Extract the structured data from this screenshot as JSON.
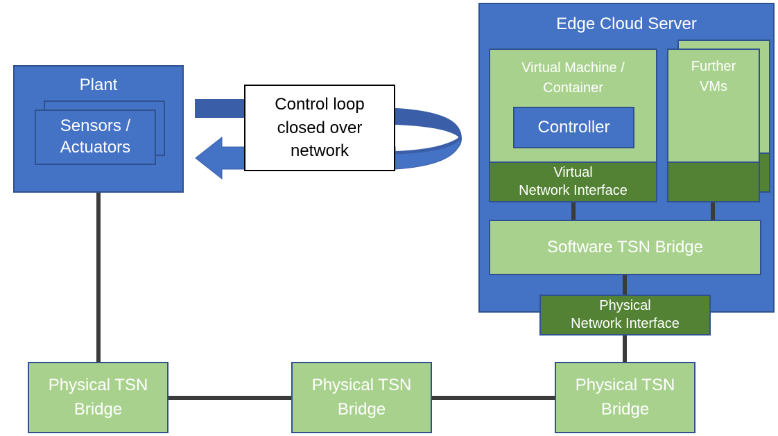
{
  "colors": {
    "blue": "#4472c4",
    "blue_border": "#2f528f",
    "light_green": "#a9d18e",
    "dark_green": "#548235",
    "wire": "#3b3b3b",
    "arrow_dark": "#3a5fa8",
    "arrow_light": "#4472c4"
  },
  "plant": {
    "title": "Plant",
    "sensors_line1": "Sensors /",
    "sensors_line2": "Actuators"
  },
  "control_loop": {
    "line1": "Control loop",
    "line2": "closed over",
    "line3": "network"
  },
  "edge_server": {
    "title": "Edge Cloud Server",
    "vm": {
      "line1": "Virtual Machine  /",
      "line2": "Container",
      "controller": "Controller",
      "vni_line1": "Virtual",
      "vni_line2": "Network Interface"
    },
    "further_vms": {
      "line1": "Further",
      "line2": "VMs"
    },
    "software_bridge": "Software TSN Bridge",
    "pni_line1": "Physical",
    "pni_line2": "Network Interface"
  },
  "physical_bridges": [
    {
      "line1": "Physical TSN",
      "line2": "Bridge"
    },
    {
      "line1": "Physical TSN",
      "line2": "Bridge"
    },
    {
      "line1": "Physical TSN",
      "line2": "Bridge"
    }
  ]
}
